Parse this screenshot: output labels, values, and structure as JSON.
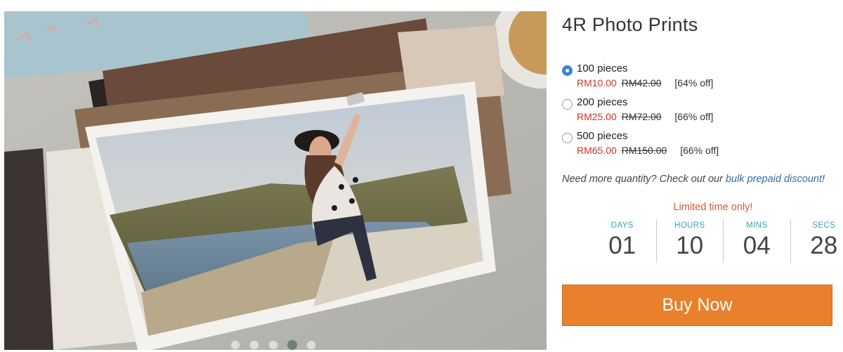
{
  "product": {
    "title": "4R Photo Prints"
  },
  "options": [
    {
      "label": "100 pieces",
      "price": "RM10.00",
      "original_price": "RM42.00",
      "discount": "[64% off]",
      "selected": true
    },
    {
      "label": "200 pieces",
      "price": "RM25.00",
      "original_price": "RM72.00",
      "discount": "[66% off]",
      "selected": false
    },
    {
      "label": "500 pieces",
      "price": "RM65.00",
      "original_price": "RM150.00",
      "discount": "[66% off]",
      "selected": false
    }
  ],
  "bulk": {
    "text": "Need more quantity? Check out our ",
    "link_text": "bulk prepaid discount",
    "suffix": "!"
  },
  "promo": {
    "limited_text": "Limited time only!"
  },
  "countdown": [
    {
      "label": "DAYS",
      "value": "01"
    },
    {
      "label": "HOURS",
      "value": "10"
    },
    {
      "label": "MINS",
      "value": "04"
    },
    {
      "label": "SECS",
      "value": "28"
    }
  ],
  "buy_button": {
    "label": "Buy Now"
  },
  "carousel": {
    "slide_count": 5,
    "active_index": 3
  },
  "colors": {
    "price_red": "#d0332a",
    "accent_orange": "#e8802c",
    "countdown_teal": "#3aa3b8",
    "link_blue": "#2f6fae",
    "radio_blue": "#3a86d8"
  }
}
